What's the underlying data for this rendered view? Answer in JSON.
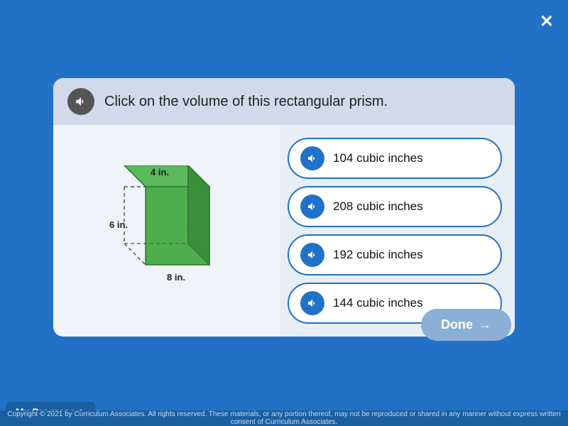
{
  "page": {
    "background_color": "#2172C7",
    "close_label": "✕"
  },
  "question": {
    "text": "Click on the volume of this rectangular prism.",
    "shape": {
      "dim1": "4 in.",
      "dim2": "6 in.",
      "dim3": "8 in."
    }
  },
  "answers": [
    {
      "id": "a1",
      "label": "104 cubic inches"
    },
    {
      "id": "a2",
      "label": "208 cubic inches"
    },
    {
      "id": "a3",
      "label": "192 cubic inches"
    },
    {
      "id": "a4",
      "label": "144 cubic inches"
    }
  ],
  "done_button": {
    "label": "Done",
    "arrow": "→"
  },
  "progress": {
    "label": "My Progress",
    "arrow": ">"
  },
  "copyright": {
    "text": "Copyright © 2021 by Curriculum Associates. All rights reserved. These materials, or any portion thereof, may not be reproduced or shared in any manner without express written consent of Curriculum Associates."
  }
}
